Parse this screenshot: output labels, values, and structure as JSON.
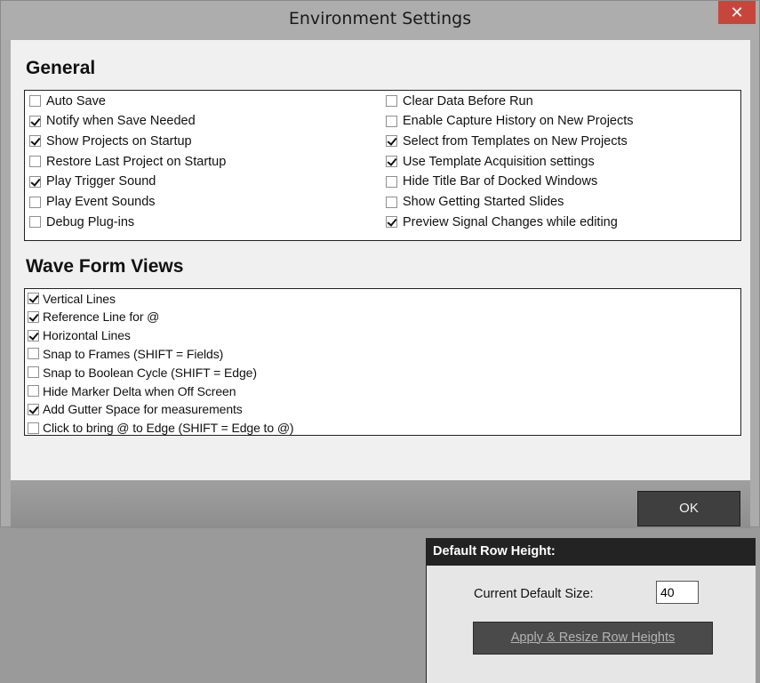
{
  "window": {
    "title": "Environment Settings",
    "close_glyph": "✕"
  },
  "general": {
    "title": "General",
    "left": [
      {
        "label": "Auto Save",
        "checked": false
      },
      {
        "label": "Notify when Save Needed",
        "checked": true
      },
      {
        "label": "Show Projects on Startup",
        "checked": true
      },
      {
        "label": "Restore Last Project on Startup",
        "checked": false
      },
      {
        "label": "Play Trigger Sound",
        "checked": true
      },
      {
        "label": "Play Event Sounds",
        "checked": false
      },
      {
        "label": "Debug Plug-ins",
        "checked": false
      }
    ],
    "right": [
      {
        "label": "Clear Data Before Run",
        "checked": false
      },
      {
        "label": "Enable Capture History on New Projects",
        "checked": false
      },
      {
        "label": "Select from Templates on New Projects",
        "checked": true
      },
      {
        "label": "Use Template Acquisition settings",
        "checked": true
      },
      {
        "label": "Hide Title Bar of Docked Windows",
        "checked": false
      },
      {
        "label": "Show Getting Started Slides",
        "checked": false
      },
      {
        "label": "Preview Signal Changes while editing",
        "checked": true
      }
    ]
  },
  "waveform": {
    "title": "Wave Form Views",
    "items": [
      {
        "label": "Vertical Lines",
        "checked": true
      },
      {
        "label": "Reference Line for @",
        "checked": true
      },
      {
        "label": "Horizontal Lines",
        "checked": true
      },
      {
        "label": "Snap to Frames (SHIFT = Fields)",
        "checked": false
      },
      {
        "label": "Snap to Boolean Cycle (SHIFT = Edge)",
        "checked": false
      },
      {
        "label": "Hide Marker Delta when Off Screen",
        "checked": false
      },
      {
        "label": "Add Gutter Space for measurements",
        "checked": true
      },
      {
        "label": "Click to bring @ to Edge (SHIFT = Edge to @)",
        "checked": false
      }
    ]
  },
  "row_height": {
    "header": "Default Row Height:",
    "size_label": "Current Default Size:",
    "size_value": "40",
    "apply_label": "Apply & Resize Row Heights"
  },
  "footer": {
    "ok_label": "OK"
  }
}
